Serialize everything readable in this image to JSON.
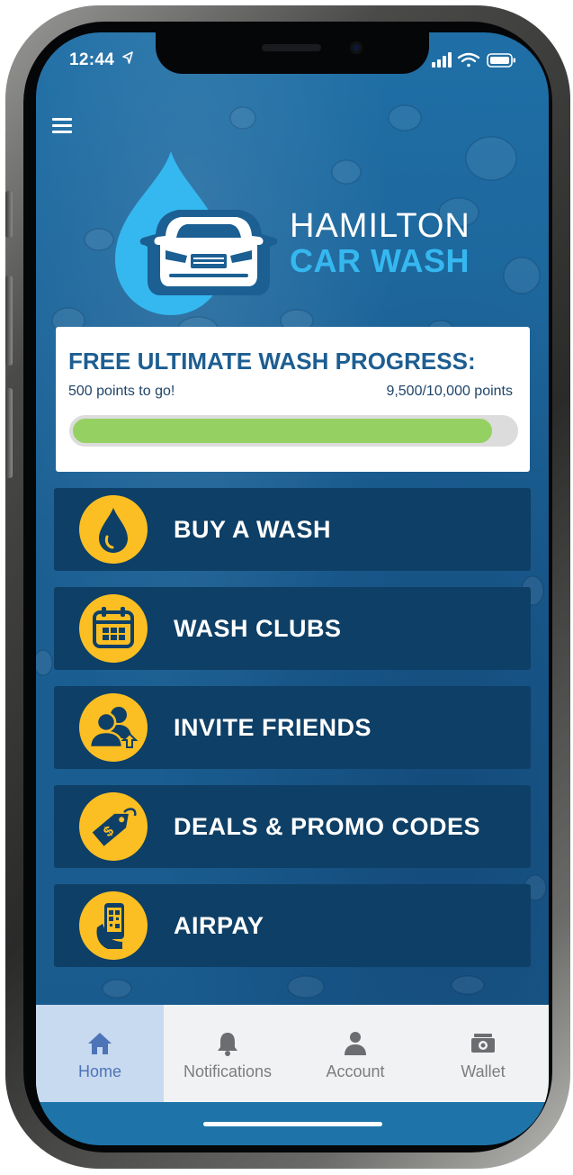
{
  "status_bar": {
    "time": "12:44"
  },
  "brand": {
    "line1": "HAMILTON",
    "line2": "CAR WASH"
  },
  "progress": {
    "title": "FREE ULTIMATE WASH PROGRESS:",
    "remaining": "500 points to go!",
    "points": "9,500/10,000 points",
    "fraction": 0.95,
    "fill_color": "#95d162"
  },
  "actions": [
    {
      "label": "BUY A WASH",
      "icon": "water-drop-icon"
    },
    {
      "label": "WASH CLUBS",
      "icon": "calendar-icon"
    },
    {
      "label": "INVITE FRIENDS",
      "icon": "invite-friends-icon"
    },
    {
      "label": "DEALS & PROMO CODES",
      "icon": "price-tag-icon"
    },
    {
      "label": "AIRPAY",
      "icon": "phone-in-hand-icon"
    }
  ],
  "tabs": [
    {
      "label": "Home",
      "icon": "home-icon",
      "active": true
    },
    {
      "label": "Notifications",
      "icon": "bell-icon",
      "active": false
    },
    {
      "label": "Account",
      "icon": "person-icon",
      "active": false
    },
    {
      "label": "Wallet",
      "icon": "money-icon",
      "active": false
    }
  ],
  "colors": {
    "screen_background": "#1b5f93",
    "button_background": "#0e3f66",
    "icon_circle": "#fbbf23",
    "brand_accent": "#35b8ef",
    "progress_title": "#1d5e92",
    "active_tab": "#c8daef"
  }
}
